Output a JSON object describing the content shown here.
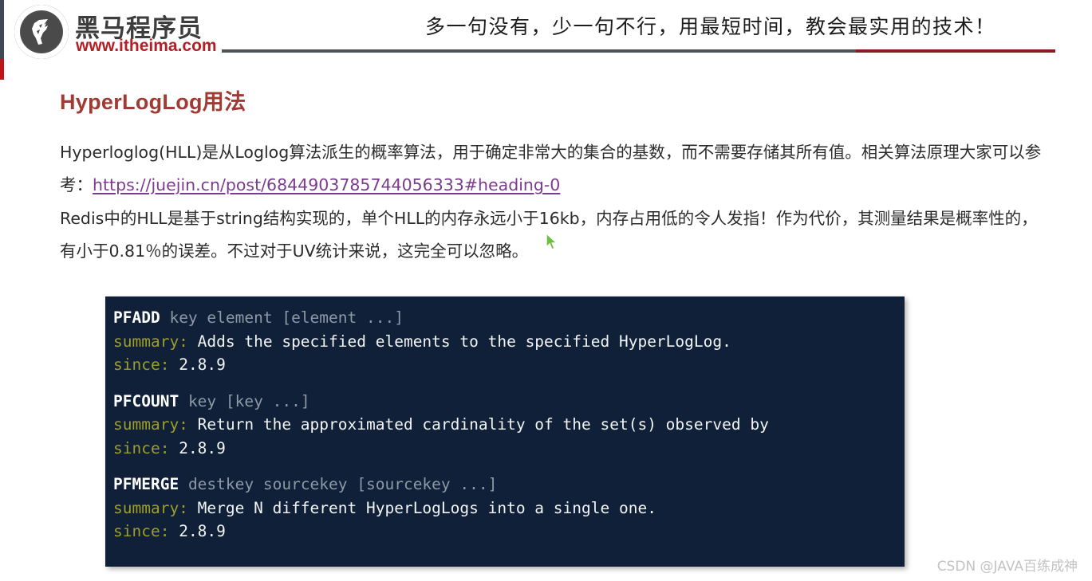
{
  "header": {
    "brand_cn": "黑马程序员",
    "brand_url": "www.itheima.com",
    "slogan": "多一句没有，少一句不行，用最短时间，教会最实用的技术！",
    "rule_gray_color": "#4e5358",
    "rule_red_color": "#8b1b22"
  },
  "content": {
    "title": "HyperLogLog用法",
    "title_color": "#a03a33",
    "paragraphs": {
      "p1_before": "Hyperloglog(HLL)是从Loglog算法派生的概率算法，用于确定非常大的集合的基数，而不需要存储其所有值。相关算法原理大家可以参考：",
      "p1_link": "https://juejin.cn/post/6844903785744056333#heading-0",
      "p1_link_color": "#7b3b8e",
      "p2": "Redis中的HLL是基于string结构实现的，单个HLL的内存永远小于16kb，内存占用低的令人发指！作为代价，其测量结果是概率性的，有小于0.81％的误差。不过对于UV统计来说，这完全可以忽略。"
    }
  },
  "code_block": {
    "background": "#0f2038",
    "keyword_color": "#9e9e28",
    "arg_color": "#8e99a6",
    "groups": [
      {
        "command": "PFADD",
        "args": "key element [element ...]",
        "summary_label": "summary:",
        "summary_text": "Adds the specified elements to the specified HyperLogLog.",
        "since_label": "since:",
        "since_value": "2.8.9"
      },
      {
        "command": "PFCOUNT",
        "args": "key [key ...]",
        "summary_label": "summary:",
        "summary_text": "Return the approximated cardinality of the set(s) observed by",
        "since_label": "since:",
        "since_value": "2.8.9"
      },
      {
        "command": "PFMERGE",
        "args": "destkey sourcekey [sourcekey ...]",
        "summary_label": "summary:",
        "summary_text": "Merge N different HyperLogLogs into a single one.",
        "since_label": "since:",
        "since_value": "2.8.9"
      }
    ]
  },
  "watermark": "CSDN @JAVA百练成神"
}
